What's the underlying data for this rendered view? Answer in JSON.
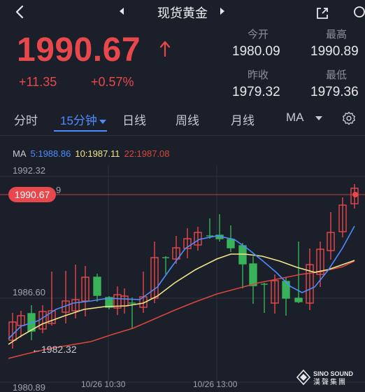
{
  "header": {
    "title": "现货黄金"
  },
  "quote": {
    "price": "1990.67",
    "change": "+11.35",
    "change_pct": "+0.57%",
    "open_label": "今开",
    "open_value": "1980.09",
    "high_label": "最高",
    "high_value": "1990.89",
    "prev_close_label": "昨收",
    "prev_close_value": "1979.32",
    "low_label": "最低",
    "low_value": "1979.36"
  },
  "tabs": {
    "items": [
      "分时",
      "15分钟",
      "日线",
      "周线",
      "月线",
      "MA"
    ],
    "active": "15分钟"
  },
  "ma": {
    "label": "MA",
    "ma5": "5:1988.86",
    "ma10": "10:1987.11",
    "ma22": "22:1987.08",
    "colors": {
      "ma5": "#4e8cff",
      "ma10": "#f2e58a",
      "ma22": "#d9463b"
    }
  },
  "chart": {
    "y_top_label": "1992.32",
    "y_mid_label": "1986.60",
    "y_bottom_label": "1980.89",
    "current_price_tag": "1990.67",
    "current_price_tag_suffix": "9",
    "min_marker": "←1982.32",
    "x_labels": [
      "10/26 10:30",
      "10/26 13:00"
    ],
    "up_color": "#e8484c",
    "down_color": "#39b359"
  },
  "logo": {
    "line1": "SINO SOUND",
    "line2": "漢聲集團"
  }
}
